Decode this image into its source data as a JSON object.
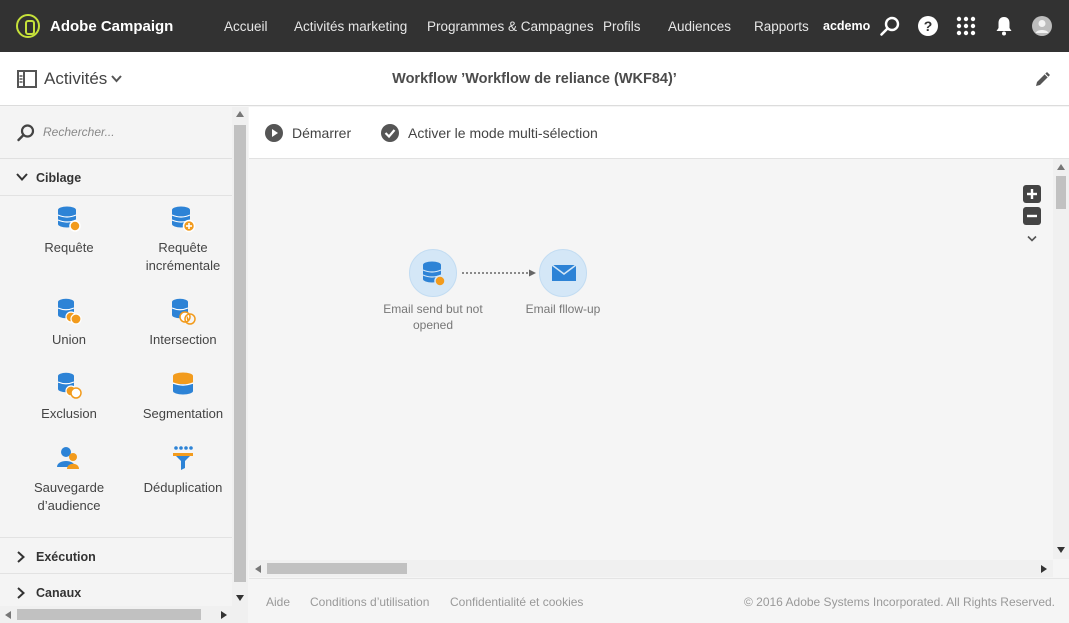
{
  "app": {
    "name": "Adobe Campaign",
    "accent": "#c6e13a"
  },
  "nav": {
    "items": [
      "Accueil",
      "Activités marketing",
      "Programmes & Campagnes",
      "Profils",
      "Audiences",
      "Rapports"
    ],
    "user": "acdemo"
  },
  "subbar": {
    "panel_title": "Activités",
    "workflow_title": "Workflow ’Workflow de reliance (WKF84)’"
  },
  "panel": {
    "search_placeholder": "Rechercher...",
    "sections": {
      "targeting": "Ciblage",
      "execution": "Exécution",
      "channels": "Canaux"
    },
    "activities": [
      "Requête",
      "Requête incrémentale",
      "Union",
      "Intersection",
      "Exclusion",
      "Segmentation",
      "Sauvegarde d’audience",
      "Déduplication"
    ]
  },
  "toolbar": {
    "start": "Démarrer",
    "multiselect": "Activer le mode multi-sélection"
  },
  "canvas": {
    "nodes": [
      {
        "label": "Email send but not opened",
        "icon": "database-icon"
      },
      {
        "label": "Email fllow-up",
        "icon": "envelope-icon"
      }
    ]
  },
  "footer": {
    "help": "Aide",
    "terms": "Conditions d’utilisation",
    "privacy": "Confidentialité et cookies",
    "copyright": "© 2016 Adobe Systems Incorporated. All Rights Reserved."
  },
  "colors": {
    "topbar": "#323232",
    "node_fill": "#d4e7f7",
    "icon_blue": "#2d83d6",
    "icon_orange": "#f29b1d"
  }
}
